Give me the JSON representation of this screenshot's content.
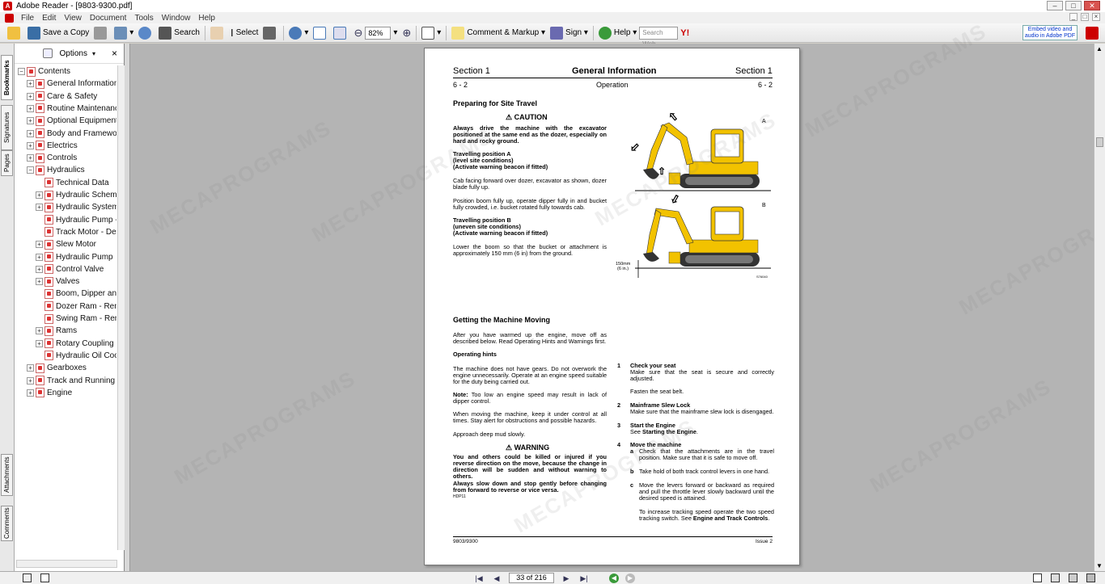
{
  "window": {
    "title": "Adobe Reader - [9803-9300.pdf]"
  },
  "menu": [
    "File",
    "Edit",
    "View",
    "Document",
    "Tools",
    "Window",
    "Help"
  ],
  "toolbar": {
    "save_copy": "Save a Copy",
    "search": "Search",
    "select": "Select",
    "zoom": "82%",
    "comment_markup": "Comment & Markup",
    "sign": "Sign",
    "help": "Help",
    "search_web_placeholder": "Search Web",
    "yahoo": "Y!",
    "embed": "Embed video and audio in Adobe PDF"
  },
  "side_tabs": [
    "Bookmarks",
    "Signatures",
    "Pages",
    "Attachments",
    "Comments"
  ],
  "nav": {
    "options": "Options",
    "close": "×"
  },
  "bookmarks": [
    {
      "label": "Contents",
      "level": 0,
      "exp": "−"
    },
    {
      "label": "General Information",
      "level": 1,
      "exp": "+"
    },
    {
      "label": "Care & Safety",
      "level": 1,
      "exp": "+"
    },
    {
      "label": "Routine Maintenance",
      "level": 1,
      "exp": "+"
    },
    {
      "label": "Optional Equipment",
      "level": 1,
      "exp": "+"
    },
    {
      "label": "Body and Framework",
      "level": 1,
      "exp": "+"
    },
    {
      "label": "Electrics",
      "level": 1,
      "exp": "+"
    },
    {
      "label": "Controls",
      "level": 1,
      "exp": "+"
    },
    {
      "label": "Hydraulics",
      "level": 1,
      "exp": "−"
    },
    {
      "label": "Technical Data",
      "level": 2,
      "exp": ""
    },
    {
      "label": "Hydraulic Schematic",
      "level": 2,
      "exp": "+"
    },
    {
      "label": "Hydraulic System",
      "level": 2,
      "exp": "+"
    },
    {
      "label": "Hydraulic Pump - ",
      "level": 2,
      "exp": ""
    },
    {
      "label": "Track Motor - Des",
      "level": 2,
      "exp": ""
    },
    {
      "label": "Slew Motor",
      "level": 2,
      "exp": "+"
    },
    {
      "label": "Hydraulic Pump",
      "level": 2,
      "exp": "+"
    },
    {
      "label": "Control Valve",
      "level": 2,
      "exp": "+"
    },
    {
      "label": "Valves",
      "level": 2,
      "exp": "+"
    },
    {
      "label": "Boom, Dipper and",
      "level": 2,
      "exp": ""
    },
    {
      "label": "Dozer Ram - Rem",
      "level": 2,
      "exp": ""
    },
    {
      "label": "Swing Ram - Rem",
      "level": 2,
      "exp": ""
    },
    {
      "label": "Rams",
      "level": 2,
      "exp": "+"
    },
    {
      "label": "Rotary Coupling",
      "level": 2,
      "exp": "+"
    },
    {
      "label": "Hydraulic Oil Coo",
      "level": 2,
      "exp": ""
    },
    {
      "label": "Gearboxes",
      "level": 1,
      "exp": "+"
    },
    {
      "label": "Track and Running G",
      "level": 1,
      "exp": "+"
    },
    {
      "label": "Engine",
      "level": 1,
      "exp": "+"
    }
  ],
  "page": {
    "section_left": "Section 1",
    "title": "General Information",
    "section_right": "Section 1",
    "pg_left": "6 - 2",
    "subtitle": "Operation",
    "pg_right": "6 - 2",
    "h1": "Preparing for Site Travel",
    "caution": "CAUTION",
    "caution_text": "Always drive the machine with the excavator positioned at the same end as the dozer, especially on hard and rocky ground.",
    "posA_title": "Travelling position A",
    "posA_sub1": "(level site conditions)",
    "posA_sub2": "(Activate warning beacon if fitted)",
    "posA_text1": "Cab facing forward over dozer, excavator as shown, dozer blade fully up.",
    "posA_text2": "Position boom fully up, operate dipper fully in and bucket fully crowded, i.e. bucket rotated fully towards cab.",
    "posB_title": "Travelling position B",
    "posB_sub1": "(uneven site conditions)",
    "posB_sub2": "(Activate warning beacon if fitted)",
    "posB_text": "Lower the boom so that the bucket or attachment is approximately 150 mm (6 in) from the ground.",
    "figA": "A",
    "figB": "B",
    "fig_dim1": "150mm",
    "fig_dim2": "(6 in.)",
    "fig_ref": "S76040",
    "h2": "Getting the Machine Moving",
    "moving_text": "After you have warmed up the engine, move off as described below. Read Operating Hints and Warnings first.",
    "hints_title": "Operating hints",
    "hints_text": "The machine does not have gears. Do not overwork the engine unnecessarily. Operate at an engine speed suitable for the duty being carried out.",
    "note_label": "Note:",
    "note_text": " Too low an engine speed may result in lack of dipper control.",
    "moving_text2": "When moving the machine, keep it under control at all times. Stay alert for obstructions and possible hazards.",
    "mud_text": "Approach deep mud slowly.",
    "warning": "WARNING",
    "warning_text": "You and others could be killed or injured if you reverse direction on the move, because the change in direction will be sudden and without warning to others.",
    "warning_text2": "Always slow down and stop gently before changing from forward to reverse or vice versa.",
    "warning_ref": "HDP11",
    "steps": [
      {
        "num": "1",
        "title": "Check your seat",
        "text": "Make sure that the seat is secure and correctly adjusted.",
        "text2": "Fasten the seat belt."
      },
      {
        "num": "2",
        "title": "Mainframe Slew Lock",
        "text": "Make sure that the mainframe slew lock is disengaged."
      },
      {
        "num": "3",
        "title": "Start the Engine",
        "text": "See ",
        "bold": "Starting the Engine",
        "end": "."
      },
      {
        "num": "4",
        "title": "Move the machine"
      }
    ],
    "sub": [
      {
        "l": "a",
        "text": "Check that the attachments are in the travel position. Make sure that it is safe to move off."
      },
      {
        "l": "b",
        "text": "Take hold of both track control levers in one hand."
      },
      {
        "l": "c",
        "text": "Move the levers forward or backward as required and pull the throttle lever slowly backward until the desired speed is attained."
      }
    ],
    "speed_text": "To increase tracking speed operate the two speed tracking switch. See ",
    "speed_bold": "Engine and Track Controls",
    "speed_end": ".",
    "footer_left": "9803/9300",
    "footer_right": "Issue 2"
  },
  "status": {
    "page_indicator": "33 of 216"
  },
  "watermark": "MECAPROGRAMS",
  "colors": {
    "accent": "#f2c200",
    "machine_dark": "#333333"
  }
}
